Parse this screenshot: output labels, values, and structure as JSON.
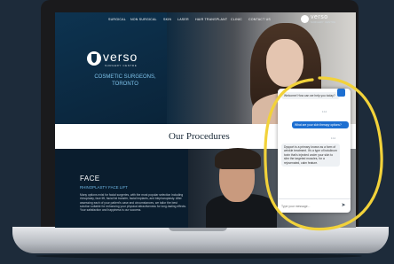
{
  "nav": {
    "items": [
      "SURGICAL",
      "NON SURGICAL",
      "SKIN",
      "LASER",
      "HAIR TRANSPLANT",
      "CLINIC",
      "CONTACT US"
    ],
    "logo_name": "verso",
    "logo_sub": "SURGERY CENTRE"
  },
  "hero": {
    "logo_name": "verso",
    "logo_sub": "SURGERY CENTRE",
    "title_line1": "COSMETIC SURGEONS,",
    "title_line2": "TORONTO"
  },
  "procedures": {
    "title": "Our Procedures"
  },
  "face": {
    "title": "FACE",
    "subtitle": "RHINOPLASTY   FACE LIFT",
    "body": "Many options exist for facial surgeries, with the most popular selection including rhinoplasty, face lift, facial fat transfer, facial implants, and blepharoplasty. After assessing each of your patient's case and circumstances, we tailor the best solution suitable for enhancing your physical attractiveness for long-lasting effects. Your satisfaction and happiness is our success."
  },
  "chat": {
    "msg1": "Welcome! How can we help you today?",
    "time1": "1:12",
    "user_msg": "What are your skin therapy options?",
    "time2": "1:12",
    "msg2": "Dysport is a primary known as a form of wrinkle treatment. It's a type of botulinum toxin that's injected under your skin to slim the targeted muscles, for a rejuvenated, calm feature.",
    "input_placeholder": "Type your message...",
    "send_icon": "send-icon"
  },
  "colors": {
    "accent": "#1d6fd1",
    "annotation": "#f2d23a",
    "hero_title": "#7ec2ea"
  }
}
